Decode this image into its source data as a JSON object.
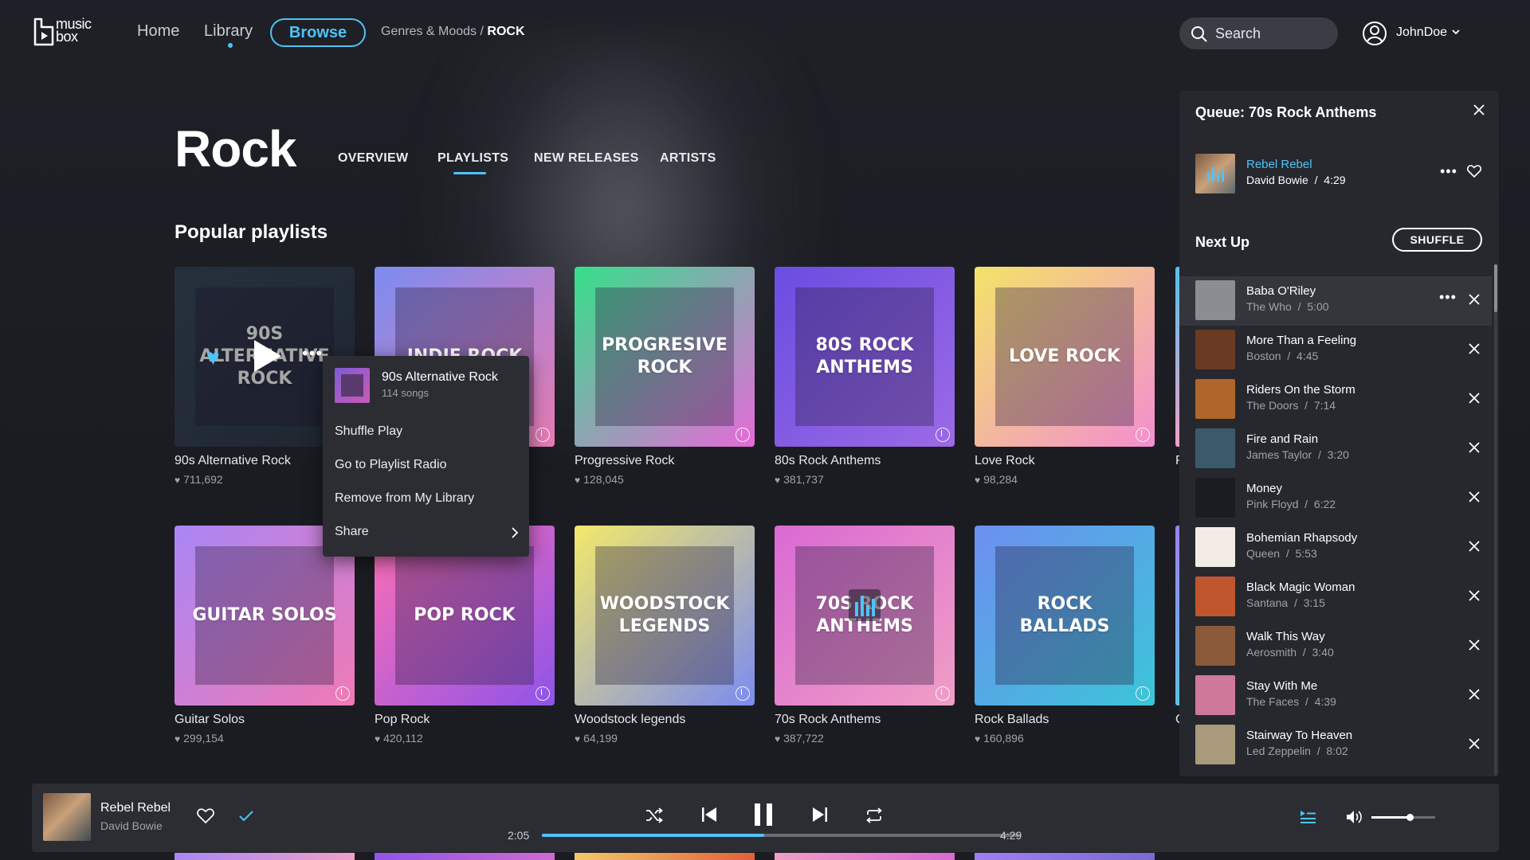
{
  "app": {
    "logo_text": "music box"
  },
  "nav": {
    "home": "Home",
    "library": "Library",
    "browse": "Browse",
    "breadcrumb_parent": "Genres & Moods",
    "breadcrumb_sep": " / ",
    "breadcrumb_current": "ROCK"
  },
  "search": {
    "label": "Search"
  },
  "user": {
    "name": "JohnDoe"
  },
  "page": {
    "title": "Rock",
    "tabs": [
      "OVERVIEW",
      "PLAYLISTS",
      "NEW RELEASES",
      "ARTISTS"
    ],
    "active_tab": "PLAYLISTS",
    "section_title": "Popular playlists"
  },
  "playlists_row1": [
    {
      "art_text": "90s ALTERNATIVE ROCK",
      "name": "90s Alternative Rock",
      "likes": "711,692",
      "colors": [
        "#3b4b5e",
        "#2f3b4a"
      ]
    },
    {
      "art_text": "INDIE ROCK",
      "name": "",
      "likes": "",
      "colors": [
        "#7c8cf0",
        "#e77ab2"
      ]
    },
    {
      "art_text": "PROGRESIVE ROCK",
      "name": "Progressive Rock",
      "likes": "128,045",
      "colors": [
        "#35e08a",
        "#e66ad9"
      ]
    },
    {
      "art_text": "80s ROCK ANTHEMS",
      "name": "80s Rock Anthems",
      "likes": "381,737",
      "colors": [
        "#6a4de0",
        "#9c6ae6"
      ]
    },
    {
      "art_text": "LOVE ROCK",
      "name": "Love Rock",
      "likes": "98,284",
      "colors": [
        "#f3e36a",
        "#f38ed0"
      ]
    }
  ],
  "playlists_row2": [
    {
      "art_text": "GUITAR SOLOS",
      "name": "Guitar Solos",
      "likes": "299,154",
      "colors": [
        "#a986f5",
        "#f07ab5"
      ]
    },
    {
      "art_text": "POP ROCK",
      "name": "Pop Rock",
      "likes": "420,112",
      "colors": [
        "#ff6fb4",
        "#8f54e8"
      ]
    },
    {
      "art_text": "WOODSTOCK LEGENDS",
      "name": "Woodstock legends",
      "likes": "64,199",
      "colors": [
        "#f3e86a",
        "#7a8cf0"
      ]
    },
    {
      "art_text": "70s ROCK ANTHEMS",
      "name": "70s Rock Anthems",
      "likes": "387,722",
      "colors": [
        "#d96ad3",
        "#f09ec6"
      ]
    },
    {
      "art_text": "ROCK BALLADS",
      "name": "Rock Ballads",
      "likes": "160,896",
      "colors": [
        "#6d8ff0",
        "#3bc5d8"
      ]
    }
  ],
  "partial_col": {
    "row1_initial": "P",
    "row2_initial": "C"
  },
  "context_menu": {
    "title": "90s Alternative Rock",
    "subtitle": "114 songs",
    "items": [
      "Shuffle Play",
      "Go to Playlist Radio",
      "Remove from My Library",
      "Share"
    ]
  },
  "queue": {
    "title": "Queue: 70s Rock Anthems",
    "now_playing": {
      "title": "Rebel Rebel",
      "artist": "David Bowie",
      "duration": "4:29"
    },
    "next_up_label": "Next Up",
    "shuffle_label": "SHUFFLE",
    "tracks": [
      {
        "title": "Baba O'Riley",
        "artist": "The Who",
        "duration": "5:00",
        "color": "#8a8d92"
      },
      {
        "title": "More Than a Feeling",
        "artist": "Boston",
        "duration": "4:45",
        "color": "#6a3a22"
      },
      {
        "title": "Riders On the Storm",
        "artist": "The Doors",
        "duration": "7:14",
        "color": "#b0652a"
      },
      {
        "title": "Fire and Rain",
        "artist": "James Taylor",
        "duration": "3:20",
        "color": "#3b5a6a"
      },
      {
        "title": "Money",
        "artist": "Pink Floyd",
        "duration": "6:22",
        "color": "#1a1c22"
      },
      {
        "title": "Bohemian Rhapsody",
        "artist": "Queen",
        "duration": "5:53",
        "color": "#f2ece4"
      },
      {
        "title": "Black Magic Woman",
        "artist": "Santana",
        "duration": "3:15",
        "color": "#c0562e"
      },
      {
        "title": "Walk This Way",
        "artist": "Aerosmith",
        "duration": "3:40",
        "color": "#8a5a3a"
      },
      {
        "title": "Stay With Me",
        "artist": "The Faces",
        "duration": "4:39",
        "color": "#d0789a"
      },
      {
        "title": "Stairway To Heaven",
        "artist": "Led Zeppelin",
        "duration": "8:02",
        "color": "#a89a7a"
      }
    ]
  },
  "player": {
    "title": "Rebel Rebel",
    "artist": "David Bowie",
    "elapsed": "2:05",
    "total": "4:29",
    "progress": 0.465,
    "volume": 0.6
  },
  "colors": {
    "accent": "#4fc3f7"
  },
  "icons": [
    "logo-icon",
    "search-icon",
    "user-icon",
    "chevron-down-icon",
    "play-icon",
    "heart-icon",
    "more-icon",
    "download-icon",
    "close-icon",
    "equalizer-icon",
    "shuffle-icon",
    "previous-icon",
    "pause-icon",
    "next-icon",
    "repeat-icon",
    "queue-icon",
    "volume-icon",
    "check-icon",
    "chevron-right-icon"
  ]
}
